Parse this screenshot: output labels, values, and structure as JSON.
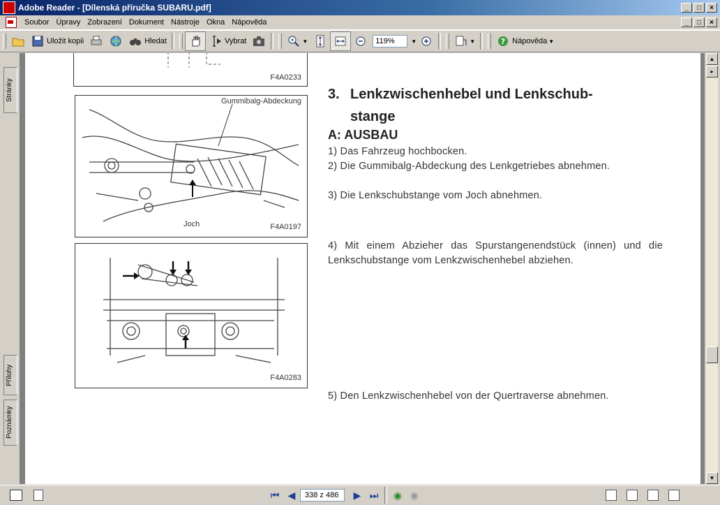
{
  "window": {
    "title": "Adobe Reader - [Dílenská příručka SUBARU.pdf]",
    "min": "_",
    "max": "□",
    "close": "×"
  },
  "menu": [
    "Soubor",
    "Úpravy",
    "Zobrazení",
    "Dokument",
    "Nástroje",
    "Okna",
    "Nápověda"
  ],
  "toolbar": {
    "save_copy": "Uložit kopii",
    "search": "Hledat",
    "select": "Vybrat",
    "zoom": "119%",
    "help": "Nápověda"
  },
  "side_tabs": {
    "pages": "Stránky",
    "attachments": "Přílohy",
    "comments": "Poznámky"
  },
  "status": {
    "page_indicator": "338 z 486"
  },
  "document": {
    "fig_top_code": "F4A0233",
    "fig1": {
      "callout": "Gummibalg-Abdeckung",
      "label": "Joch",
      "code": "F4A0197"
    },
    "fig2": {
      "code": "F4A0283"
    },
    "section_number": "3.",
    "section_title_line1": "Lenkzwischenhebel und Lenkschub-",
    "section_title_line2": "stange",
    "subheading": "A: AUSBAU",
    "steps": {
      "s1": "1) Das Fahrzeug hochbocken.",
      "s2": "2) Die Gummibalg-Abdeckung des Lenkgetriebes abnehmen.",
      "s3": "3) Die Lenkschubstange vom Joch abnehmen.",
      "s4": "4) Mit einem Abzieher das Spurstangenendstück (innen) und die Lenkschubstange vom Lenkzwischenhebel abziehen.",
      "s5": "5) Den Lenkzwischenhebel von der Quertraverse abnehmen."
    }
  }
}
